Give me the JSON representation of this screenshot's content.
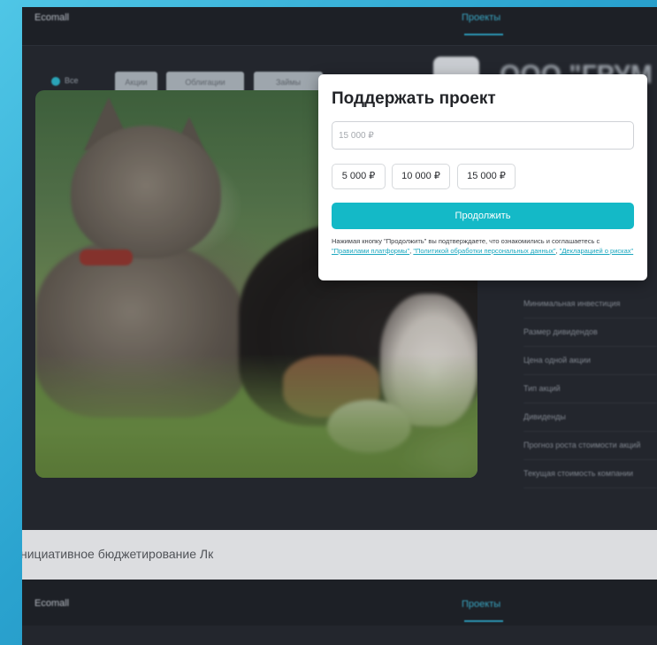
{
  "topbar": {
    "brand": "Ecomall",
    "active_tab": "Проекты"
  },
  "filters": {
    "radio_label": "Все",
    "chips": [
      "Акции",
      "Облигации",
      "Займы"
    ]
  },
  "company": {
    "name": "ООО \"ГРУМ"
  },
  "params": [
    "Минимальная инвестиция",
    "Размер дивидендов",
    "Цена одной акции",
    "Тип акций",
    "Дивиденды",
    "Прогноз роста стоимости акций",
    "Текущая стоимость компании"
  ],
  "band": {
    "text": "нициативное бюджетирование Лк"
  },
  "modal": {
    "title": "Поддержать проект",
    "amount_value": "",
    "amount_placeholder": "15 000 ₽",
    "presets": [
      "5 000 ₽",
      "10 000 ₽",
      "15 000 ₽"
    ],
    "continue_label": "Продолжить",
    "legal": {
      "prefix": "Нажимая кнопку \"Продолжить\" вы подтверждаете, что ознакомились и соглашаетесь с ",
      "link1": "\"Правилами платформы\"",
      "sep1": ", ",
      "link2": "\"Политикой обработки персональных данных\"",
      "sep2": ", ",
      "link3": "\"Декларацией о рисках\""
    }
  },
  "colors": {
    "accent": "#14b9c7",
    "link": "#1aa7bf",
    "page_bg_dark": "#23262d"
  }
}
